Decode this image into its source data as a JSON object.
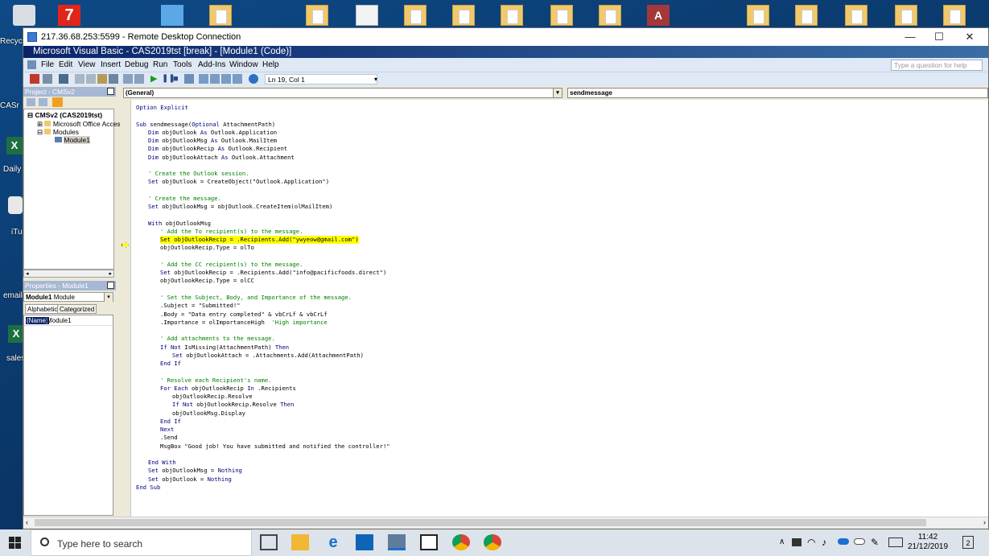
{
  "desktop": {
    "icons": [
      {
        "label": "Recyc"
      },
      {
        "label": "CASr"
      },
      {
        "label": "Daily"
      },
      {
        "label": "iTu"
      },
      {
        "label": "email"
      },
      {
        "label": "sales"
      }
    ]
  },
  "rdp": {
    "title": "217.36.68.253:5599 - Remote Desktop Connection",
    "minimize": "—",
    "maximize": "☐",
    "close": "✕"
  },
  "vb": {
    "title": "Microsoft Visual Basic - CAS2019tst [break] - [Module1 (Code)]",
    "menu": [
      "File",
      "Edit",
      "View",
      "Insert",
      "Debug",
      "Run",
      "Tools",
      "Add-Ins",
      "Window",
      "Help"
    ],
    "ask_placeholder": "Type a question for help",
    "status": "Ln 19, Col 1",
    "project": {
      "header": "Project - CMSv2",
      "tree": {
        "root": "CMSv2 (CAS2019tst)",
        "office": "Microsoft Office Access",
        "modules": "Modules",
        "module1": "Module1"
      }
    },
    "properties": {
      "header": "Properties - Module1",
      "selector_name": "Module1",
      "selector_type": "Module",
      "tab_alpha": "Alphabetic",
      "tab_cat": "Categorized",
      "row_name": "(Name)",
      "row_value": "Module1"
    },
    "combo_left": "(General)",
    "combo_right": "sendmessage",
    "code": [
      {
        "i": 0,
        "parts": [
          {
            "t": "Option Explicit",
            "c": "kw"
          }
        ]
      },
      {
        "i": 0,
        "parts": []
      },
      {
        "i": 0,
        "parts": [
          {
            "t": "Sub",
            "c": "kw"
          },
          {
            "t": " sendmessage("
          },
          {
            "t": "Optional",
            "c": "kw"
          },
          {
            "t": " AttachmentPath)"
          }
        ]
      },
      {
        "i": 1,
        "parts": [
          {
            "t": "Dim",
            "c": "kw"
          },
          {
            "t": " objOutlook "
          },
          {
            "t": "As",
            "c": "kw"
          },
          {
            "t": " Outlook.Application"
          }
        ]
      },
      {
        "i": 1,
        "parts": [
          {
            "t": "Dim",
            "c": "kw"
          },
          {
            "t": " objOutlookMsg "
          },
          {
            "t": "As",
            "c": "kw"
          },
          {
            "t": " Outlook.MailItem"
          }
        ]
      },
      {
        "i": 1,
        "parts": [
          {
            "t": "Dim",
            "c": "kw"
          },
          {
            "t": " objOutlookRecip "
          },
          {
            "t": "As",
            "c": "kw"
          },
          {
            "t": " Outlook.Recipient"
          }
        ]
      },
      {
        "i": 1,
        "parts": [
          {
            "t": "Dim",
            "c": "kw"
          },
          {
            "t": " objOutlookAttach "
          },
          {
            "t": "As",
            "c": "kw"
          },
          {
            "t": " Outlook.Attachment"
          }
        ]
      },
      {
        "i": 0,
        "parts": []
      },
      {
        "i": 1,
        "parts": [
          {
            "t": "' Create the Outlook session.",
            "c": "cm"
          }
        ]
      },
      {
        "i": 1,
        "parts": [
          {
            "t": "Set",
            "c": "kw"
          },
          {
            "t": " objOutlook = CreateObject(\"Outlook.Application\")"
          }
        ]
      },
      {
        "i": 0,
        "parts": []
      },
      {
        "i": 1,
        "parts": [
          {
            "t": "' Create the message.",
            "c": "cm"
          }
        ]
      },
      {
        "i": 1,
        "parts": [
          {
            "t": "Set",
            "c": "kw"
          },
          {
            "t": " objOutlookMsg = objOutlook.CreateItem(olMailItem)"
          }
        ]
      },
      {
        "i": 0,
        "parts": []
      },
      {
        "i": 1,
        "parts": [
          {
            "t": "With",
            "c": "kw"
          },
          {
            "t": " objOutlookMsg"
          }
        ]
      },
      {
        "i": 2,
        "parts": [
          {
            "t": "' Add the To recipient(s) to the message.",
            "c": "cm"
          }
        ]
      },
      {
        "i": 2,
        "hl": true,
        "parts": [
          {
            "t": "Set objOutlookRecip = .Recipients.Add(\"ywyeow@gmail.com\")"
          }
        ]
      },
      {
        "i": 2,
        "parts": [
          {
            "t": "objOutlookRecip.Type = olTo"
          }
        ]
      },
      {
        "i": 0,
        "parts": []
      },
      {
        "i": 2,
        "parts": [
          {
            "t": "' Add the CC recipient(s) to the message.",
            "c": "cm"
          }
        ]
      },
      {
        "i": 2,
        "parts": [
          {
            "t": "Set",
            "c": "kw"
          },
          {
            "t": " objOutlookRecip = .Recipients.Add(\"info@pacificfoods.direct\")"
          }
        ]
      },
      {
        "i": 2,
        "parts": [
          {
            "t": "objOutlookRecip.Type = olCC"
          }
        ]
      },
      {
        "i": 0,
        "parts": []
      },
      {
        "i": 2,
        "parts": [
          {
            "t": "' Set the Subject, Body, and Importance of the message.",
            "c": "cm"
          }
        ]
      },
      {
        "i": 2,
        "parts": [
          {
            "t": ".Subject = \"Submitted!\""
          }
        ]
      },
      {
        "i": 2,
        "parts": [
          {
            "t": ".Body = \"Data entry completed\" & vbCrLf & vbCrLf"
          }
        ]
      },
      {
        "i": 2,
        "parts": [
          {
            "t": ".Importance = olImportanceHigh  "
          },
          {
            "t": "'High importance",
            "c": "cm"
          }
        ]
      },
      {
        "i": 0,
        "parts": []
      },
      {
        "i": 2,
        "parts": [
          {
            "t": "' Add attachments to the message.",
            "c": "cm"
          }
        ]
      },
      {
        "i": 2,
        "parts": [
          {
            "t": "If Not",
            "c": "kw"
          },
          {
            "t": " IsMissing(AttachmentPath) "
          },
          {
            "t": "Then",
            "c": "kw"
          }
        ]
      },
      {
        "i": 3,
        "parts": [
          {
            "t": "Set",
            "c": "kw"
          },
          {
            "t": " objOutlookAttach = .Attachments.Add(AttachmentPath)"
          }
        ]
      },
      {
        "i": 2,
        "parts": [
          {
            "t": "End If",
            "c": "kw"
          }
        ]
      },
      {
        "i": 0,
        "parts": []
      },
      {
        "i": 2,
        "parts": [
          {
            "t": "' Resolve each Recipient's name.",
            "c": "cm"
          }
        ]
      },
      {
        "i": 2,
        "parts": [
          {
            "t": "For Each",
            "c": "kw"
          },
          {
            "t": " objOutlookRecip "
          },
          {
            "t": "In",
            "c": "kw"
          },
          {
            "t": " .Recipients"
          }
        ]
      },
      {
        "i": 3,
        "parts": [
          {
            "t": "objOutlookRecip.Resolve"
          }
        ]
      },
      {
        "i": 3,
        "parts": [
          {
            "t": "If Not",
            "c": "kw"
          },
          {
            "t": " objOutlookRecip.Resolve "
          },
          {
            "t": "Then",
            "c": "kw"
          }
        ]
      },
      {
        "i": 3,
        "parts": [
          {
            "t": "objOutlookMsg.Display"
          }
        ]
      },
      {
        "i": 2,
        "parts": [
          {
            "t": "End If",
            "c": "kw"
          }
        ]
      },
      {
        "i": 2,
        "parts": [
          {
            "t": "Next",
            "c": "kw"
          }
        ]
      },
      {
        "i": 2,
        "parts": [
          {
            "t": ".Send"
          }
        ]
      },
      {
        "i": 2,
        "parts": [
          {
            "t": "MsgBox \"Good job! You have submitted and notified the controller!\""
          }
        ]
      },
      {
        "i": 0,
        "parts": []
      },
      {
        "i": 1,
        "parts": [
          {
            "t": "End With",
            "c": "kw"
          }
        ]
      },
      {
        "i": 1,
        "parts": [
          {
            "t": "Set",
            "c": "kw"
          },
          {
            "t": " objOutlookMsg = "
          },
          {
            "t": "Nothing",
            "c": "kw"
          }
        ]
      },
      {
        "i": 1,
        "parts": [
          {
            "t": "Set",
            "c": "kw"
          },
          {
            "t": " objOutlook = "
          },
          {
            "t": "Nothing",
            "c": "kw"
          }
        ]
      },
      {
        "i": 0,
        "parts": [
          {
            "t": "End Sub",
            "c": "kw"
          }
        ]
      }
    ]
  },
  "taskbar": {
    "search_placeholder": "Type here to search",
    "time": "11:42",
    "date": "21/12/2019",
    "notifications": "2"
  },
  "colors": {
    "vb_title_start": "#0a246a",
    "keyword": "#00007f",
    "comment": "#008000",
    "highlight": "#ffff00"
  }
}
